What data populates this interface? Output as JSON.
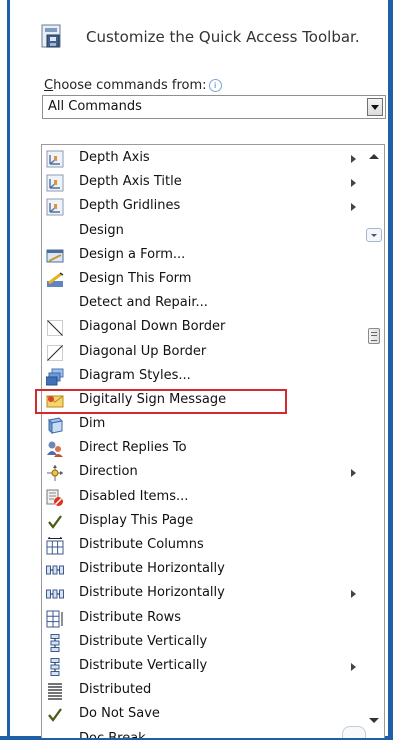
{
  "header": {
    "title": "Customize the Quick Access Toolbar.",
    "icon": "quick-access-toolbar-icon"
  },
  "choose": {
    "label_first": "C",
    "label_rest": "hoose commands from:",
    "info_glyph": "i"
  },
  "select": {
    "value": "All Commands"
  },
  "colors": {
    "frame": "#1f5fa8",
    "highlight": "#d32a2f"
  },
  "commands": [
    {
      "label": "Depth Axis",
      "icon": "depth-axis-icon",
      "submenu": true
    },
    {
      "label": "Depth Axis Title",
      "icon": "depth-axis-title-icon",
      "submenu": true
    },
    {
      "label": "Depth Gridlines",
      "icon": "depth-gridlines-icon",
      "submenu": true
    },
    {
      "label": "Design",
      "icon": "",
      "submenu": false
    },
    {
      "label": "Design a Form...",
      "icon": "design-form-icon",
      "submenu": false
    },
    {
      "label": "Design This Form",
      "icon": "design-this-form-icon",
      "submenu": false
    },
    {
      "label": "Detect and Repair...",
      "icon": "",
      "submenu": false
    },
    {
      "label": "Diagonal Down Border",
      "icon": "diagonal-down-border-icon",
      "submenu": false
    },
    {
      "label": "Diagonal Up Border",
      "icon": "diagonal-up-border-icon",
      "submenu": false
    },
    {
      "label": "Diagram Styles...",
      "icon": "diagram-styles-icon",
      "submenu": false
    },
    {
      "label": "Digitally Sign Message",
      "icon": "digitally-sign-message-icon",
      "submenu": false,
      "selected": true
    },
    {
      "label": "Dim",
      "icon": "dim-icon",
      "submenu": false
    },
    {
      "label": "Direct Replies To",
      "icon": "direct-replies-icon",
      "submenu": false
    },
    {
      "label": "Direction",
      "icon": "direction-icon",
      "submenu": true
    },
    {
      "label": "Disabled Items...",
      "icon": "disabled-items-icon",
      "submenu": false
    },
    {
      "label": "Display This Page",
      "icon": "checkmark-icon",
      "submenu": false
    },
    {
      "label": "Distribute Columns",
      "icon": "distribute-columns-icon",
      "submenu": false
    },
    {
      "label": "Distribute Horizontally",
      "icon": "distribute-horizontally-icon",
      "submenu": false
    },
    {
      "label": "Distribute Horizontally",
      "icon": "distribute-horizontally-icon",
      "submenu": true
    },
    {
      "label": "Distribute Rows",
      "icon": "distribute-rows-icon",
      "submenu": false
    },
    {
      "label": "Distribute Vertically",
      "icon": "distribute-vertically-icon",
      "submenu": false
    },
    {
      "label": "Distribute Vertically",
      "icon": "distribute-vertically-icon",
      "submenu": true
    },
    {
      "label": "Distributed",
      "icon": "distributed-icon",
      "submenu": false
    },
    {
      "label": "Do Not Save",
      "icon": "checkmark-icon",
      "submenu": false
    },
    {
      "label": "Doc Break",
      "icon": "",
      "submenu": false
    }
  ]
}
